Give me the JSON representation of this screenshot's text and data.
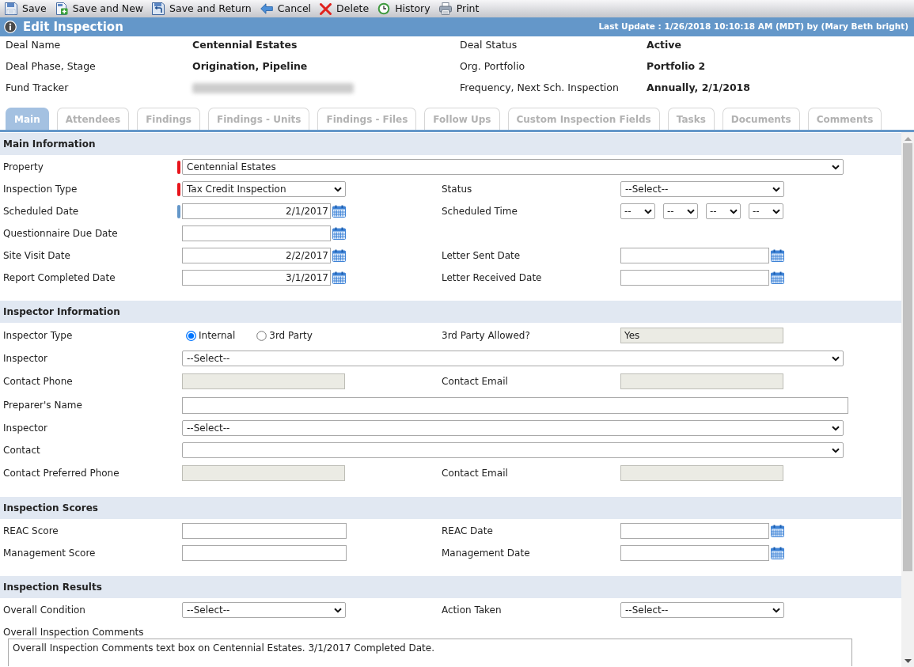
{
  "toolbar": [
    {
      "kind": "save",
      "label": "Save"
    },
    {
      "kind": "save_new",
      "label": "Save and New"
    },
    {
      "kind": "save_return",
      "label": "Save and Return"
    },
    {
      "kind": "cancel",
      "label": "Cancel"
    },
    {
      "kind": "delete",
      "label": "Delete"
    },
    {
      "kind": "history",
      "label": "History"
    },
    {
      "kind": "print",
      "label": "Print"
    }
  ],
  "header": {
    "title": "Edit Inspection",
    "last_update": "Last Update : 1/26/2018 10:10:18 AM (MDT) by (Mary Beth bright)"
  },
  "deal_info": [
    {
      "label": "Deal Name",
      "value": "Centennial Estates",
      "redacted": false
    },
    {
      "label": "Deal Status",
      "value": "Active",
      "redacted": false
    },
    {
      "label": "Deal Phase, Stage",
      "value": "Origination, Pipeline",
      "redacted": false
    },
    {
      "label": "Org. Portfolio",
      "value": "Portfolio 2",
      "redacted": false
    },
    {
      "label": "Fund Tracker",
      "redacted": true
    },
    {
      "label": "Frequency, Next Sch. Inspection",
      "value": "Annually, 2/1/2018",
      "redacted": false
    }
  ],
  "tabs": [
    {
      "label": "Main",
      "selected": true
    },
    {
      "label": "Attendees",
      "selected": false
    },
    {
      "label": "Findings",
      "selected": false
    },
    {
      "label": "Findings - Units",
      "selected": false
    },
    {
      "label": "Findings - Files",
      "selected": false
    },
    {
      "label": "Follow Ups",
      "selected": false
    },
    {
      "label": "Custom Inspection Fields",
      "selected": false
    },
    {
      "label": "Tasks",
      "selected": false
    },
    {
      "label": "Documents",
      "selected": false
    },
    {
      "label": "Comments",
      "selected": false
    }
  ],
  "sections": [
    {
      "title": "Main Information",
      "rows": [
        {
          "items": [
            {
              "label": "Property",
              "color": "#e8141b",
              "control": {
                "kind": "long_dropdown",
                "value": "Centennial Estates"
              }
            }
          ]
        },
        {
          "items": [
            {
              "label": "Inspection Type",
              "color": "#e8141b",
              "control": {
                "kind": "dropdown",
                "value": "Tax Credit Inspection"
              }
            },
            {
              "label": "Status",
              "control": {
                "kind": "dropdown",
                "value": "--Select--"
              }
            }
          ]
        },
        {
          "items": [
            {
              "label": "Scheduled Date",
              "color": "#6497c9",
              "control": {
                "kind": "date",
                "value": "2/1/2017"
              }
            },
            {
              "label": "Scheduled Time",
              "control": {
                "kind": "time",
                "parts": [
                  "--",
                  "--",
                  "--",
                  "--"
                ]
              }
            }
          ]
        },
        {
          "items": [
            {
              "label": "Questionnaire Due Date",
              "control": {
                "kind": "date"
              }
            }
          ]
        },
        {
          "items": [
            {
              "label": "Site Visit Date",
              "control": {
                "kind": "date",
                "value": "2/2/2017"
              }
            },
            {
              "label": "Letter Sent Date",
              "control": {
                "kind": "date"
              }
            }
          ]
        },
        {
          "items": [
            {
              "label": "Report Completed Date",
              "control": {
                "kind": "date",
                "value": "3/1/2017"
              }
            },
            {
              "label": "Letter Received Date",
              "control": {
                "kind": "date"
              }
            }
          ]
        }
      ]
    },
    {
      "title": "Inspector Information",
      "rows": [
        {
          "items": [
            {
              "label": "Inspector Type",
              "control": {
                "kind": "radios",
                "options": [
                  {
                    "label": "Internal",
                    "selected": true
                  },
                  {
                    "label": "3rd Party",
                    "selected": false
                  }
                ]
              }
            },
            {
              "label": "3rd Party Allowed?",
              "control": {
                "kind": "readonly",
                "value": "Yes"
              }
            }
          ]
        },
        {
          "items": [
            {
              "label": "Inspector",
              "control": {
                "kind": "long_dropdown",
                "value": "--Select--"
              }
            }
          ]
        },
        {
          "items": [
            {
              "label": "Contact Phone",
              "control": {
                "kind": "readonly"
              }
            },
            {
              "label": "Contact Email",
              "control": {
                "kind": "readonly"
              }
            }
          ]
        },
        {
          "items": [
            {
              "label": "Preparer's Name",
              "control": {
                "kind": "long_text"
              }
            }
          ]
        },
        {
          "items": [
            {
              "label": "Inspector",
              "control": {
                "kind": "long_dropdown",
                "value": "--Select--"
              }
            }
          ]
        },
        {
          "items": [
            {
              "label": "Contact",
              "control": {
                "kind": "long_dropdown"
              }
            }
          ]
        },
        {
          "items": [
            {
              "label": "Contact Preferred Phone",
              "control": {
                "kind": "readonly"
              }
            },
            {
              "label": "Contact Email",
              "control": {
                "kind": "readonly"
              }
            }
          ]
        }
      ]
    },
    {
      "title": "Inspection Scores",
      "rows": [
        {
          "items": [
            {
              "label": "REAC Score",
              "control": {
                "kind": "text"
              }
            },
            {
              "label": "REAC Date",
              "control": {
                "kind": "date"
              }
            }
          ]
        },
        {
          "items": [
            {
              "label": "Management Score",
              "control": {
                "kind": "text"
              }
            },
            {
              "label": "Management Date",
              "control": {
                "kind": "date"
              }
            }
          ]
        }
      ]
    },
    {
      "title": "Inspection Results",
      "rows": [
        {
          "items": [
            {
              "label": "Overall Condition",
              "control": {
                "kind": "dropdown",
                "value": "--Select--"
              }
            },
            {
              "label": "Action Taken",
              "control": {
                "kind": "dropdown",
                "value": "--Select--"
              }
            }
          ]
        },
        {
          "items": [
            {
              "label": "Overall Inspection Comments",
              "control": {
                "kind": "textarea",
                "value": "Overall Inspection Comments text box on Centennial Estates. 3/1/2017 Completed Date."
              }
            }
          ]
        }
      ]
    }
  ]
}
